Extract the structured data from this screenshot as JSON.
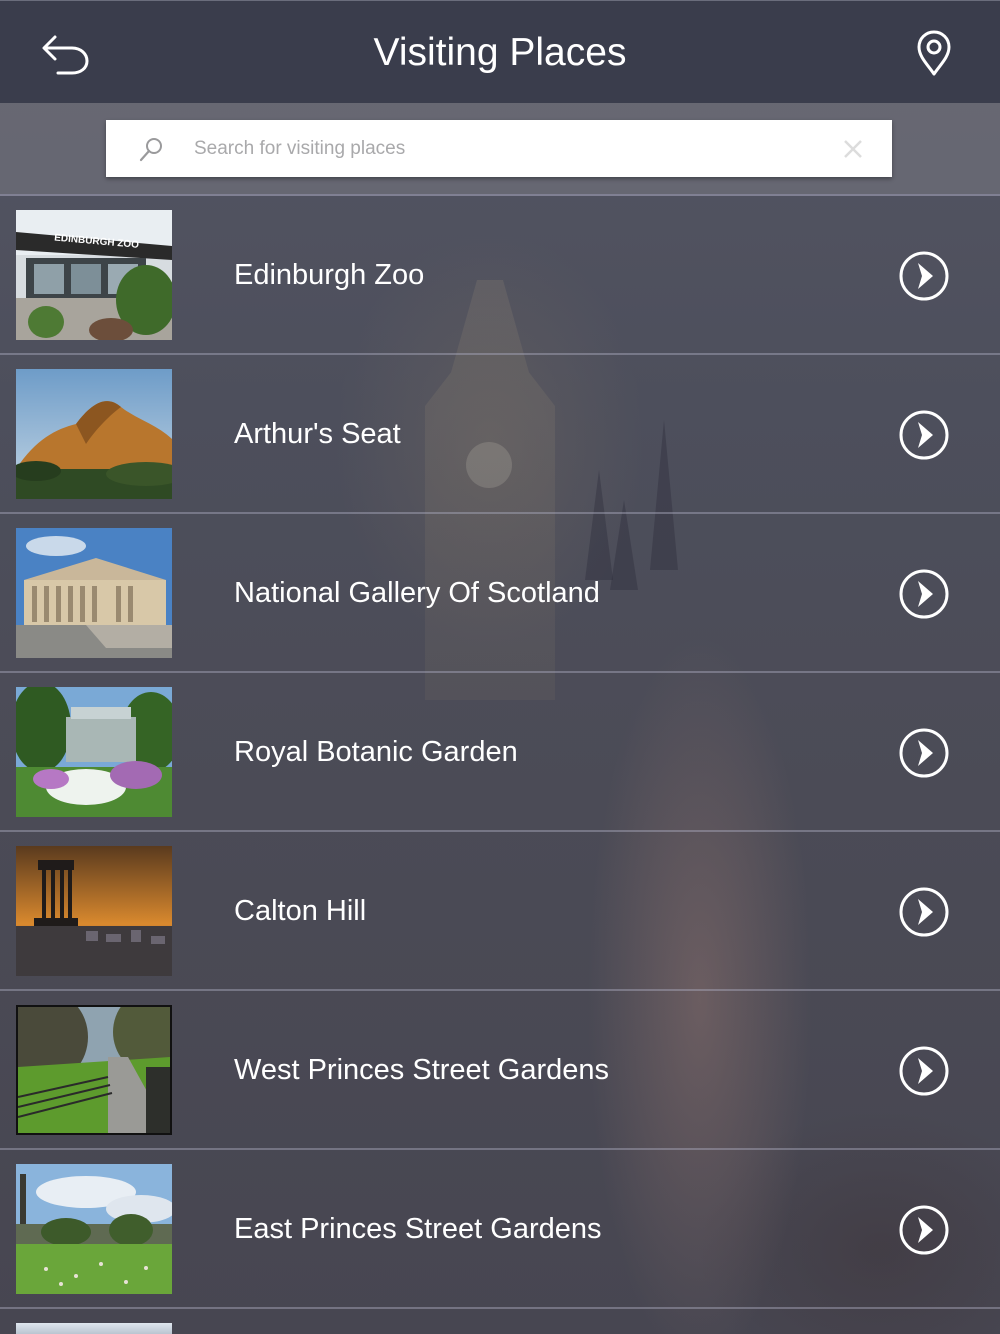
{
  "header": {
    "title": "Visiting Places",
    "back_icon": "back-arrow-icon",
    "map_icon": "location-pin-icon"
  },
  "search": {
    "placeholder": "Search for visiting places",
    "value": "",
    "search_icon": "magnifier-icon",
    "clear_icon": "clear-x-icon"
  },
  "places": [
    {
      "name": "Edinburgh Zoo",
      "thumb_text": "EDINBURGH ZOO"
    },
    {
      "name": "Arthur's Seat"
    },
    {
      "name": "National Gallery Of Scotland"
    },
    {
      "name": "Royal Botanic Garden"
    },
    {
      "name": "Calton Hill"
    },
    {
      "name": "West Princes Street Gardens"
    },
    {
      "name": "East Princes Street Gardens"
    }
  ],
  "colors": {
    "header_bg": "#3a3d4c",
    "text": "#ffffff",
    "placeholder": "#a9a9ab"
  }
}
